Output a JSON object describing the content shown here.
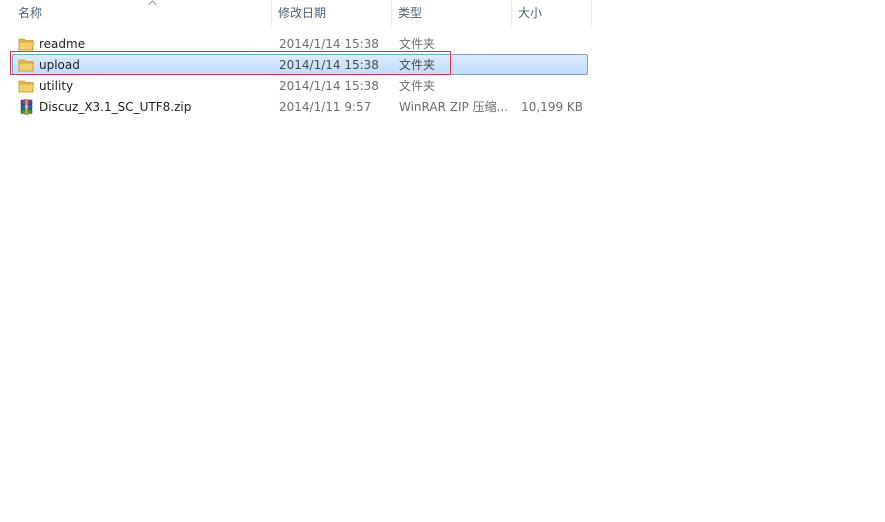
{
  "columns": {
    "name": "名称",
    "modified": "修改日期",
    "type": "类型",
    "size": "大小"
  },
  "files": [
    {
      "name": "readme",
      "modified": "2014/1/14 15:38",
      "type": "文件夹",
      "size": "",
      "icon": "folder-icon",
      "selected": false
    },
    {
      "name": "upload",
      "modified": "2014/1/14 15:38",
      "type": "文件夹",
      "size": "",
      "icon": "folder-icon",
      "selected": true
    },
    {
      "name": "utility",
      "modified": "2014/1/14 15:38",
      "type": "文件夹",
      "size": "",
      "icon": "folder-icon",
      "selected": false
    },
    {
      "name": "Discuz_X3.1_SC_UTF8.zip",
      "modified": "2014/1/11 9:57",
      "type": "WinRAR ZIP 压缩...",
      "size": "10,199 KB",
      "icon": "winrar-archive-icon",
      "selected": false
    }
  ],
  "colors": {
    "selection_border": "#7da2ce",
    "selection_fill": "#cce2fc",
    "annotation_box": "#d9363e",
    "header_text": "#4c607a"
  },
  "sort": {
    "column": "name",
    "direction": "ascending"
  }
}
